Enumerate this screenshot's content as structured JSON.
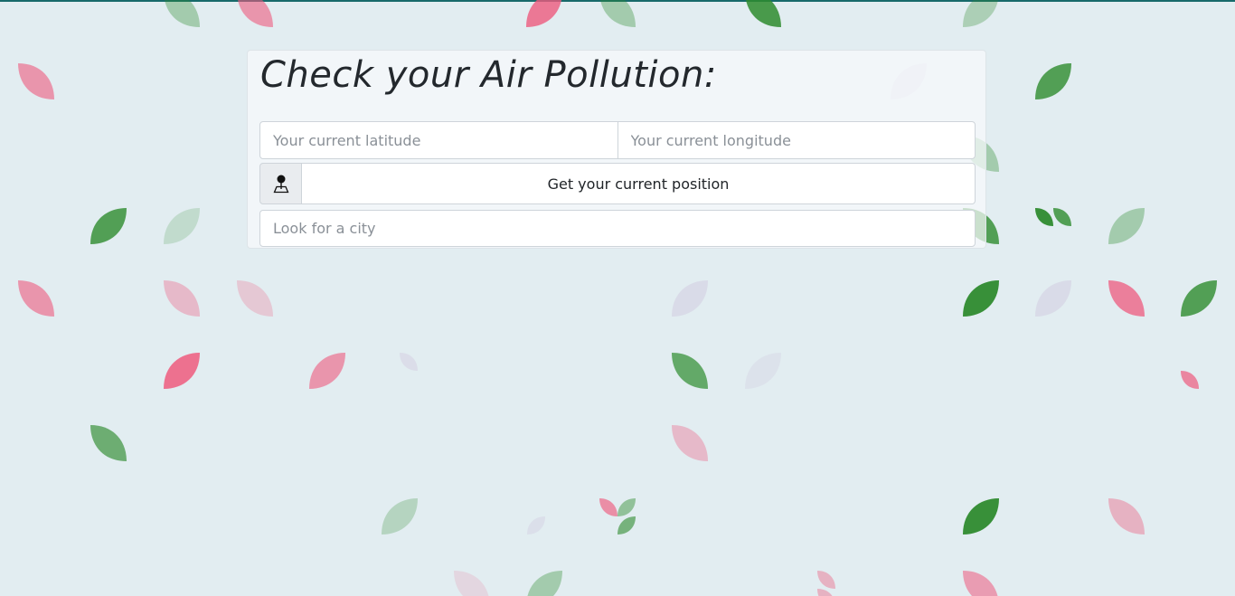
{
  "page": {
    "title": "Check your Air Pollution:"
  },
  "form": {
    "latitude_placeholder": "Your current latitude",
    "longitude_placeholder": "Your current longitude",
    "geolocate_label": "Get your current position",
    "city_placeholder": "Look for a city",
    "geolocate_icon": "map-pin-icon"
  },
  "theme": {
    "background": "#e2edf1",
    "top_border": "#176a6b",
    "leaf_green": "#2e8b2e",
    "leaf_pink": "#ee5a7e"
  }
}
